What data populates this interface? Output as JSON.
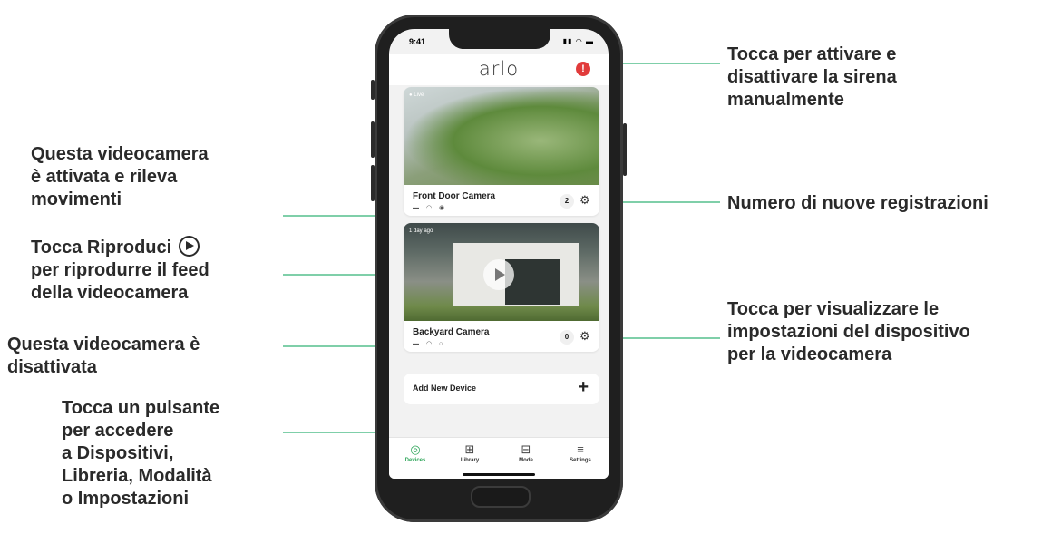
{
  "callouts": {
    "siren": [
      "Tocca per attivare e",
      "disattivare la sirena",
      "manualmente"
    ],
    "recordings": "Numero di nuove registrazioni",
    "settings": [
      "Tocca per visualizzare le",
      "impostazioni del dispositivo",
      "per la videocamera"
    ],
    "armed": [
      "Questa videocamera",
      "è attivata e rileva",
      "movimenti"
    ],
    "play": [
      "Tocca Riproduci",
      "per riprodurre il feed",
      "della videocamera"
    ],
    "disarmed": [
      "Questa videocamera è",
      "disattivata"
    ],
    "nav": [
      "Tocca un pulsante",
      "per accedere",
      "a Dispositivi,",
      "Libreria, Modalità",
      "o Impostazioni"
    ]
  },
  "phone": {
    "time": "9:41",
    "logo": "arlo",
    "siren_icon": "!",
    "cameras": [
      {
        "badge": "● Live",
        "name": "Front Door Camera",
        "count": "2"
      },
      {
        "badge": "1 day ago",
        "name": "Backyard Camera",
        "count": "0"
      }
    ],
    "add_device": "Add New Device",
    "add_symbol": "+",
    "tabs": [
      {
        "label": "Devices",
        "icon": "◎"
      },
      {
        "label": "Library",
        "icon": "⊞"
      },
      {
        "label": "Mode",
        "icon": "⊟"
      },
      {
        "label": "Settings",
        "icon": "≡"
      }
    ]
  },
  "colors": {
    "accent": "#7fcfa9",
    "active_tab": "#2fa65a",
    "siren": "#e13b3b"
  }
}
